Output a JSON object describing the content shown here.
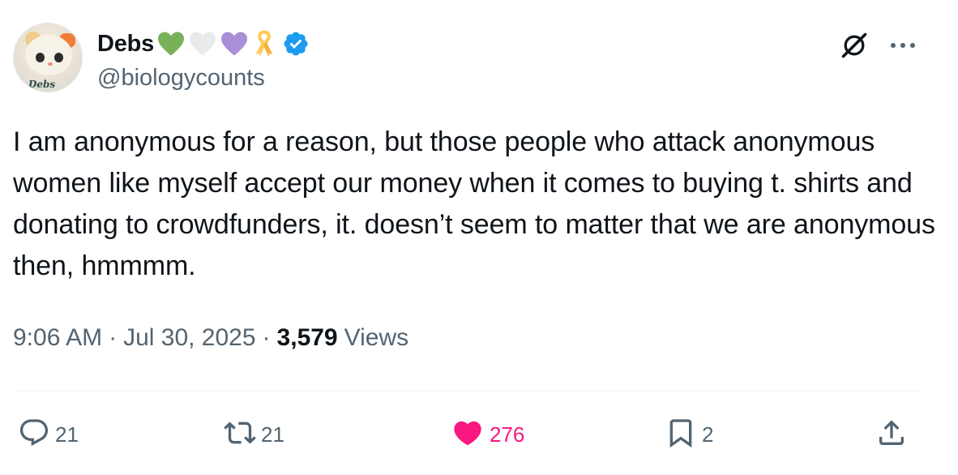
{
  "user": {
    "display_name": "Debs",
    "handle": "@biologycounts",
    "avatar_tag": "Debs",
    "name_emojis": [
      "green-heart-emoji",
      "white-heart-emoji",
      "purple-heart-emoji",
      "ribbon-emoji"
    ],
    "verified": true
  },
  "tweet": {
    "text": "I am anonymous for a reason, but those people who attack anonymous women like myself accept our money when it comes to buying t. shirts and donating to crowdfunders, it. doesn’t seem to matter that we are anonymous then, hmmmm.",
    "time": "9:06 AM",
    "date": "Jul 30, 2025",
    "separator": "·",
    "views_count": "3,579",
    "views_label": "Views"
  },
  "actions": {
    "replies": "21",
    "reposts": "21",
    "likes": "276",
    "bookmarks": "2"
  },
  "colors": {
    "text": "#0f1419",
    "muted": "#536471",
    "like": "#f91880",
    "verified": "#1d9bf0",
    "divider": "#eff3f4"
  },
  "icons": [
    "grok-icon",
    "more-icon",
    "reply-icon",
    "repost-icon",
    "heart-icon",
    "bookmark-icon",
    "share-icon"
  ]
}
